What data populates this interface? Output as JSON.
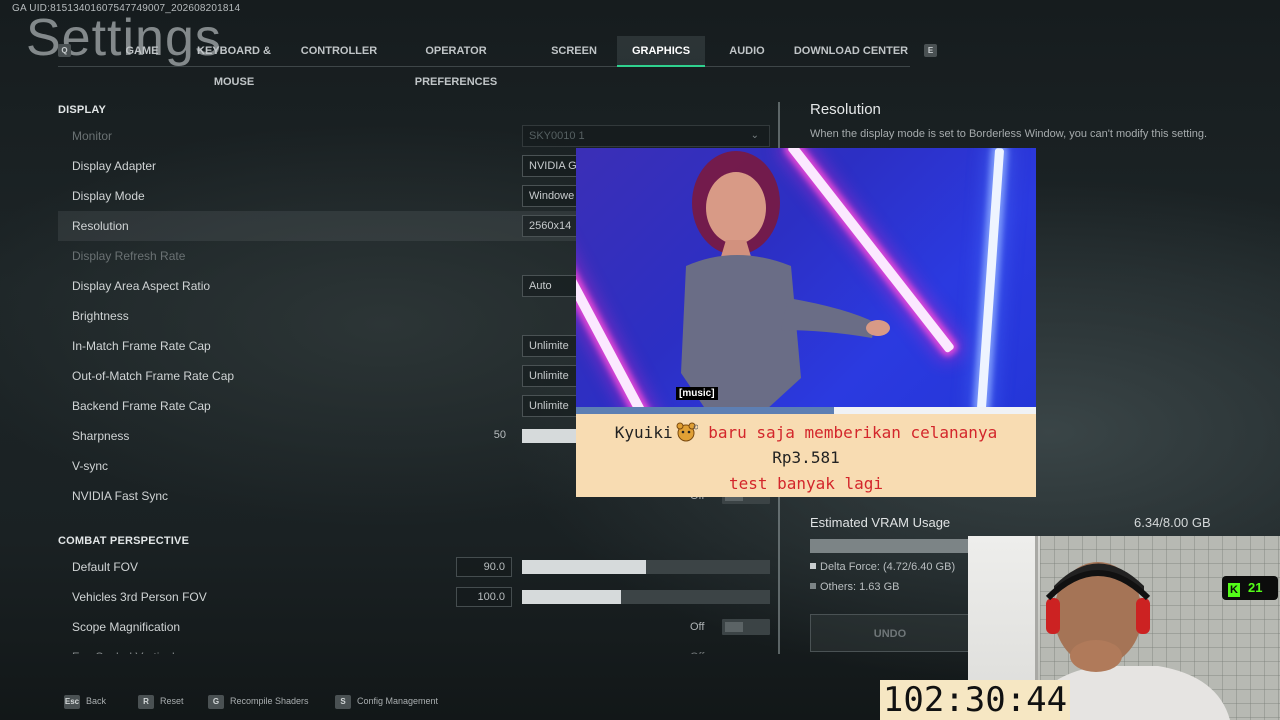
{
  "stream": {
    "uid_text": "GA UID:8151340160754774900​7_202608201814",
    "timer": "102:30:44",
    "kick_viewers": "21",
    "kick_logo": "K"
  },
  "settings": {
    "title": "Settings",
    "tab_key_left": "Q",
    "tab_key_right": "E",
    "tabs": [
      "GAME",
      "KEYBOARD & MOUSE",
      "CONTROLLER",
      "OPERATOR PREFERENCES",
      "SCREEN",
      "GRAPHICS",
      "AUDIO",
      "DOWNLOAD CENTER"
    ],
    "active_tab": "GRAPHICS",
    "display": {
      "section_title": "DISPLAY",
      "rows": [
        {
          "label": "Monitor",
          "value": "SKY0010 1"
        },
        {
          "label": "Display Adapter",
          "value": "NVIDIA G"
        },
        {
          "label": "Display Mode",
          "value": "Windowe"
        },
        {
          "label": "Resolution",
          "value": "2560x14"
        },
        {
          "label": "Display Refresh Rate",
          "value": ""
        },
        {
          "label": "Display Area Aspect Ratio",
          "value": "Auto"
        },
        {
          "label": "Brightness",
          "value": ""
        },
        {
          "label": "In-Match Frame Rate Cap",
          "value": "Unlimite"
        },
        {
          "label": "Out-of-Match Frame Rate Cap",
          "value": "Unlimite"
        },
        {
          "label": "Backend Frame Rate Cap",
          "value": "Unlimite"
        },
        {
          "label": "Sharpness",
          "value": "50",
          "level": 0.5
        },
        {
          "label": "V-sync",
          "value": ""
        },
        {
          "label": "NVIDIA Fast Sync",
          "value": "Off"
        }
      ]
    },
    "combat": {
      "section_title": "COMBAT PERSPECTIVE",
      "rows": [
        {
          "label": "Default FOV",
          "value": "90.0",
          "level": 0.5
        },
        {
          "label": "Vehicles 3rd Person FOV",
          "value": "100.0",
          "level": 0.4
        },
        {
          "label": "Scope Magnification",
          "value": "Off"
        },
        {
          "label": "Fov Scaled Vertical",
          "value": "Off"
        }
      ]
    },
    "info": {
      "title": "Resolution",
      "description": "When the display mode is set to Borderless Window, you can't modify this setting."
    },
    "vram": {
      "label": "Estimated VRAM Usage",
      "value": "6.34/8.00 GB",
      "usage_fraction": 0.79,
      "legend_delta": "Delta Force: (4.72/6.40 GB)",
      "legend_others": "Others: 1.63 GB",
      "delta_color": "#c9cdcf",
      "others_color": "#7c8486"
    },
    "undo_label": "UNDO",
    "footer": [
      {
        "key": "Esc",
        "label": "Back"
      },
      {
        "key": "R",
        "label": "Reset"
      },
      {
        "key": "G",
        "label": "Recompile Shaders"
      },
      {
        "key": "S",
        "label": "Config Management"
      }
    ]
  },
  "overlay": {
    "caption": "[music]",
    "video_progress": 0.56,
    "donation": {
      "name": "Kyuiki",
      "message": "baru saja memberikan celananya",
      "amount": "Rp3.581",
      "text": "test banyak lagi"
    }
  },
  "colors": {
    "accent_green": "#2fd18f",
    "kick_green": "#53fc18",
    "donation_bg": "#f8dcb2",
    "donation_red": "#d3262b"
  }
}
